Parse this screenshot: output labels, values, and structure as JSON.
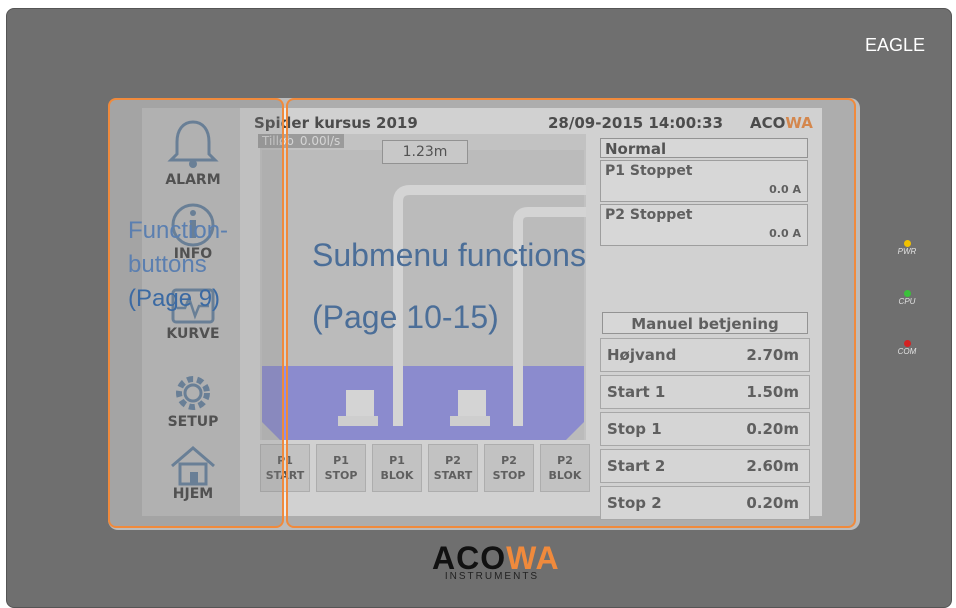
{
  "device": {
    "brand": "EAGLE",
    "leds": [
      {
        "label": "PWR",
        "color": "#f2c200"
      },
      {
        "label": "CPU",
        "color": "#3ac13a"
      },
      {
        "label": "COM",
        "color": "#d42222"
      }
    ],
    "bottom_logo": {
      "part1": "ACO",
      "part2": "WA",
      "subtitle": "INSTRUMENTS"
    }
  },
  "screen": {
    "title": "Spider kursus 2019",
    "datetime": "28/09-2015 14:00:33",
    "logo": {
      "part1": "ACO",
      "part2": "WA"
    },
    "inflow": {
      "label": "Tilløb",
      "value": "0.00l/s"
    },
    "level": "1.23m",
    "status": "Normal",
    "pumps": [
      {
        "name": "P1 Stoppet",
        "current": "0.0  A"
      },
      {
        "name": "P2 Stoppet",
        "current": "0.0  A"
      }
    ],
    "manual_button": "Manuel betjening",
    "settings": [
      {
        "label": "Højvand",
        "value": "2.70m"
      },
      {
        "label": "Start 1",
        "value": "1.50m"
      },
      {
        "label": "Stop 1",
        "value": "0.20m"
      },
      {
        "label": "Start 2",
        "value": "2.60m"
      },
      {
        "label": "Stop 2",
        "value": "0.20m"
      }
    ],
    "function_buttons": [
      {
        "label": "ALARM",
        "icon": "bell-icon"
      },
      {
        "label": "INFO",
        "icon": "info-icon"
      },
      {
        "label": "KURVE",
        "icon": "chart-icon"
      },
      {
        "label": "SETUP",
        "icon": "gear-icon"
      },
      {
        "label": "HJEM",
        "icon": "home-icon"
      }
    ],
    "pump_buttons": [
      {
        "line1": "P1",
        "line2": "START"
      },
      {
        "line1": "P1",
        "line2": "STOP"
      },
      {
        "line1": "P1",
        "line2": "BLOK"
      },
      {
        "line1": "P2",
        "line2": "START"
      },
      {
        "line1": "P2",
        "line2": "STOP"
      },
      {
        "line1": "P2",
        "line2": "BLOK"
      }
    ]
  },
  "overlays": {
    "left_line1": "Function-",
    "left_line2": "buttons",
    "left_line3": "(Page 9)",
    "right_line1": "Submenu functions",
    "right_line2": "(Page 10-15)"
  },
  "colors": {
    "accent": "#f08a3c",
    "water": "#8f8fe8",
    "annotation": "#4b6e98"
  }
}
